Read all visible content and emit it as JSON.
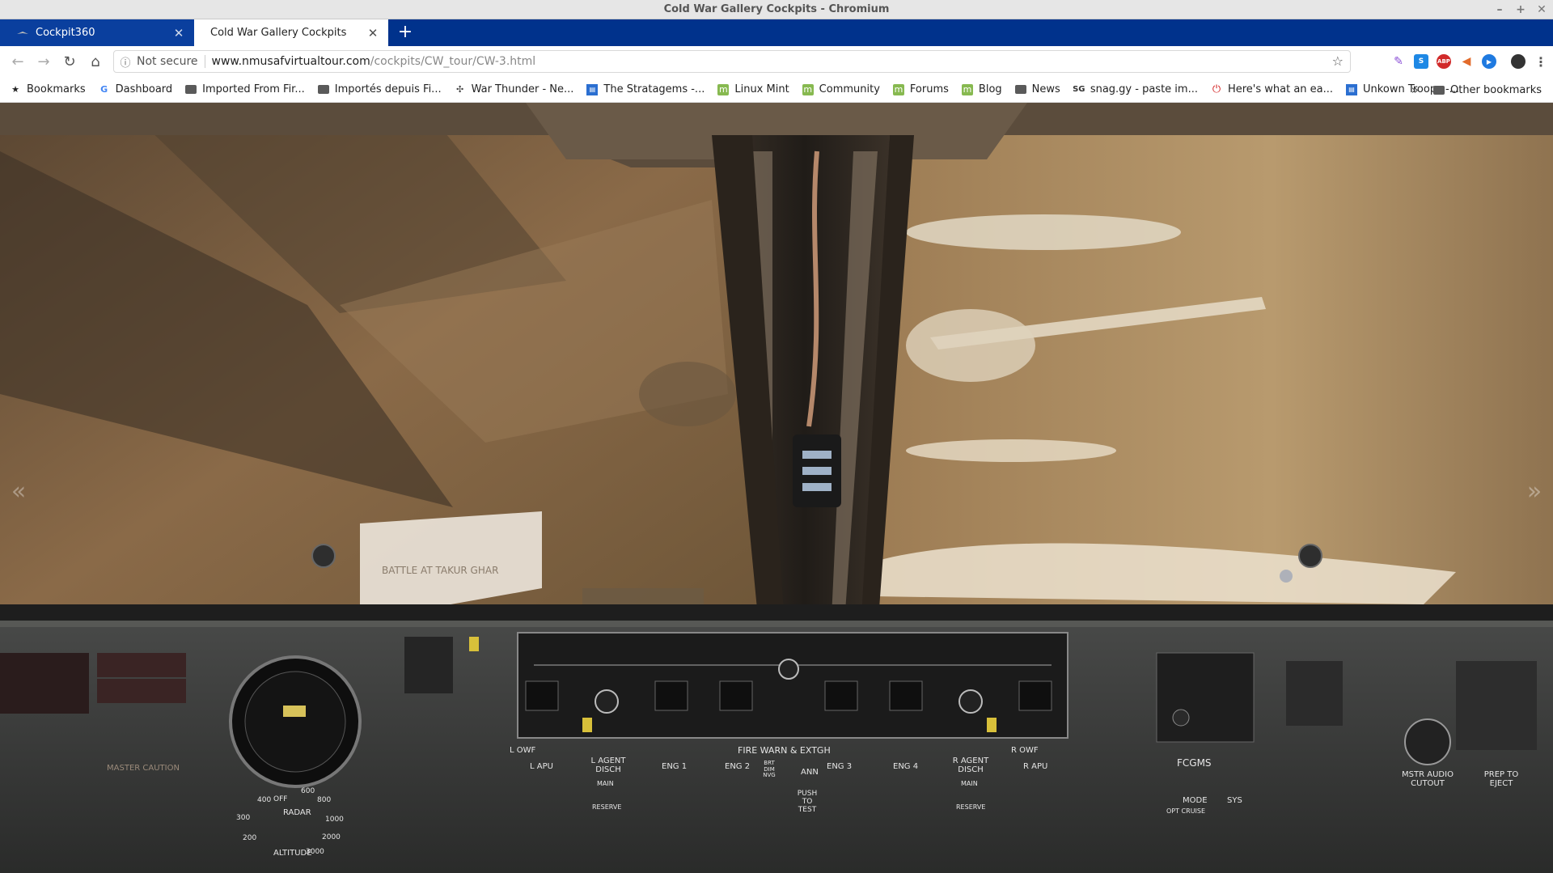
{
  "window": {
    "title": "Cold War Gallery Cockpits - Chromium"
  },
  "tabs": [
    {
      "title": "Cockpit360",
      "active": false
    },
    {
      "title": "Cold War Gallery Cockpits",
      "active": true
    }
  ],
  "toolbar": {
    "security_label": "Not secure",
    "url_host": "www.nmusafvirtualtour.com",
    "url_path": "/cockpits/CW_tour/CW-3.html"
  },
  "bookmarks": {
    "items": [
      {
        "label": "Bookmarks",
        "icon": "star-icon"
      },
      {
        "label": "Dashboard",
        "icon": "google-icon"
      },
      {
        "label": "Imported From Fir...",
        "icon": "folder-icon"
      },
      {
        "label": "Importés depuis Fi...",
        "icon": "folder-icon"
      },
      {
        "label": "War Thunder - Ne...",
        "icon": "war-thunder-icon"
      },
      {
        "label": "The Stratagems -...",
        "icon": "page-icon"
      },
      {
        "label": "Linux Mint",
        "icon": "mint-icon"
      },
      {
        "label": "Community",
        "icon": "mint-icon"
      },
      {
        "label": "Forums",
        "icon": "mint-icon"
      },
      {
        "label": "Blog",
        "icon": "mint-icon"
      },
      {
        "label": "News",
        "icon": "folder-icon"
      },
      {
        "label": "snag.gy - paste im...",
        "icon": "snag-icon"
      },
      {
        "label": "Here's what an ea...",
        "icon": "power-icon"
      },
      {
        "label": "Unkown Troops -...",
        "icon": "page-icon"
      }
    ],
    "overflow": "»",
    "other": "Other bookmarks"
  },
  "panel": {
    "fire_warn": "FIRE WARN & EXTGH",
    "l_owf": "L OWF",
    "r_owf": "R OWF",
    "l_apu": "L APU",
    "r_apu": "R APU",
    "l_agent": "L AGENT DISCH",
    "r_agent": "R AGENT DISCH",
    "main": "MAIN",
    "reserve": "RESERVE",
    "eng1": "ENG 1",
    "eng2": "ENG 2",
    "eng3": "ENG 3",
    "eng4": "ENG 4",
    "brt_dim": "BRT DIM NVG",
    "ann": "ANN",
    "push_to_test": "PUSH TO TEST",
    "fcgms": "FCGMS",
    "mode": "MODE",
    "sys": "SYS",
    "opt_cruise": "OPT CRUISE",
    "mstr_audio": "MSTR AUDIO CUTOUT",
    "prep_eject": "PREP TO EJECT",
    "master_caution": "MASTER CAUTION",
    "radar": "RADAR",
    "off": "OFF",
    "altitude": "ALTITUDE",
    "alt_ticks": [
      "200",
      "300",
      "400",
      "600",
      "800",
      "1000",
      "2000",
      "3000"
    ]
  },
  "exhibit": {
    "banner": "BATTLE AT TAKUR GHAR"
  },
  "colors": {
    "tab_strip": "#00328c",
    "glass_tint": "#8a6a42",
    "panel_gray": "#3c3d3c"
  }
}
